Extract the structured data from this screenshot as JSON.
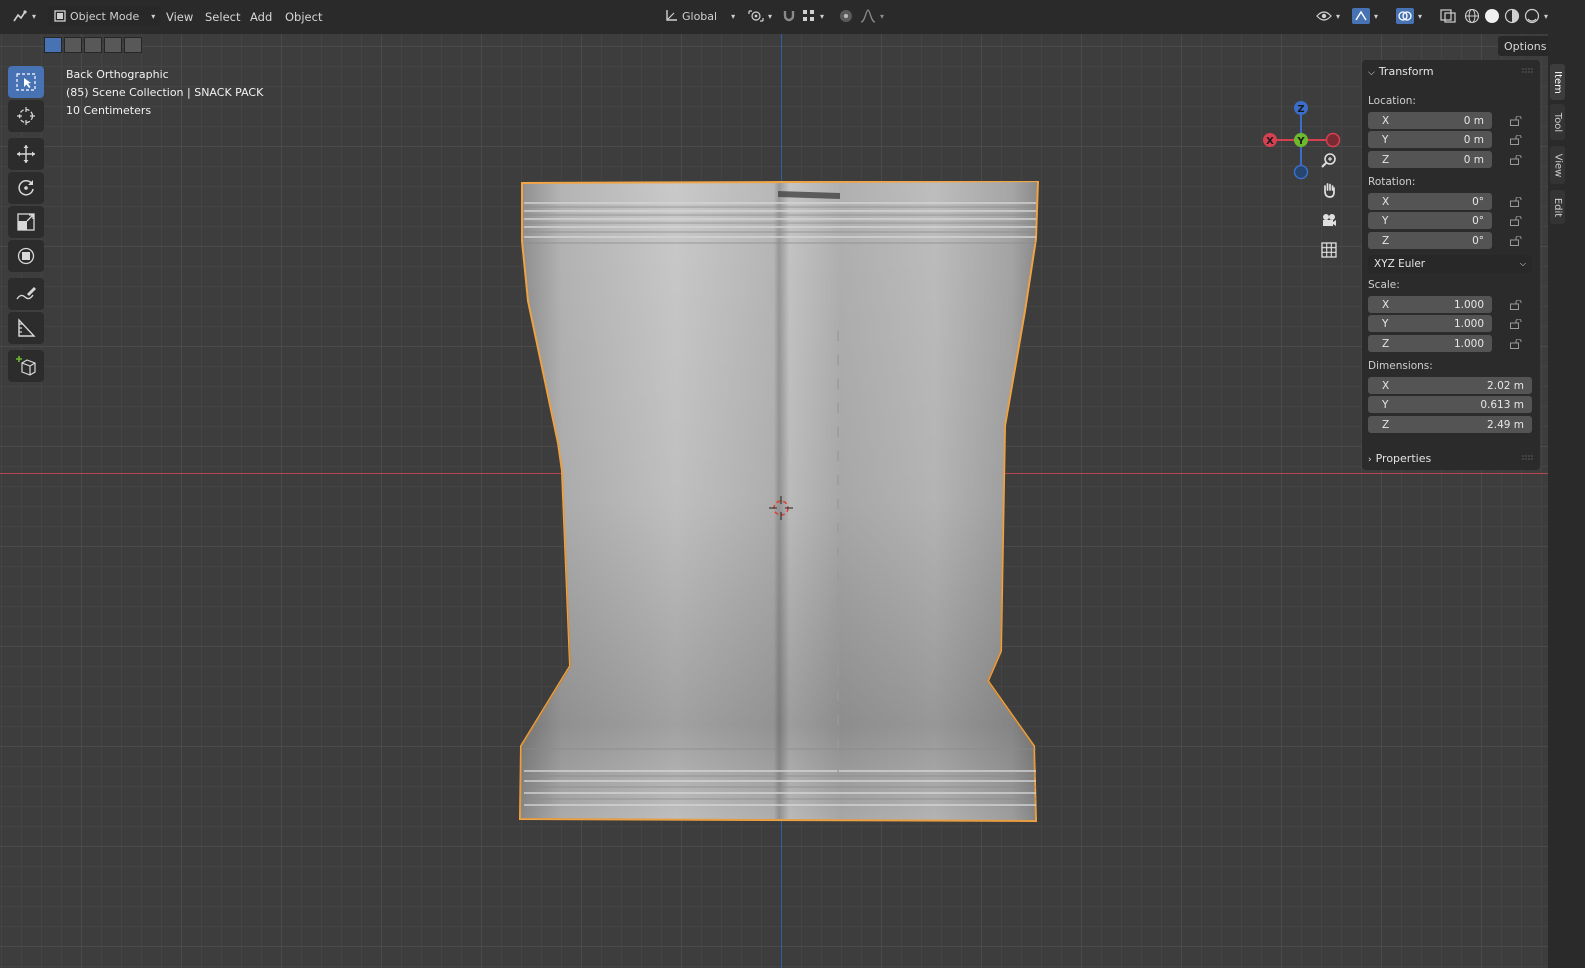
{
  "header": {
    "mode": "Object Mode",
    "menus": [
      "View",
      "Select",
      "Add",
      "Object"
    ],
    "transform_orientation": "Global",
    "options_label": "Options"
  },
  "viewport": {
    "view_name": "Back Orthographic",
    "collection_line": "(85) Scene Collection | SNACK PACK",
    "scale_line": "10 Centimeters",
    "gizmo": {
      "x": "X",
      "y": "Y",
      "z": "Z"
    }
  },
  "tools": [
    "select-box-icon",
    "cursor-icon",
    "move-icon",
    "rotate-icon",
    "scale-icon",
    "transform-icon",
    "annotate-icon",
    "measure-icon",
    "add-cube-icon"
  ],
  "nav_icons": [
    "zoom-icon",
    "pan-hand-icon",
    "camera-icon",
    "grid-view-icon"
  ],
  "sidebar": {
    "transform_title": "Transform",
    "location_label": "Location:",
    "location": [
      {
        "axis": "X",
        "value": "0 m"
      },
      {
        "axis": "Y",
        "value": "0 m"
      },
      {
        "axis": "Z",
        "value": "0 m"
      }
    ],
    "rotation_label": "Rotation:",
    "rotation": [
      {
        "axis": "X",
        "value": "0°"
      },
      {
        "axis": "Y",
        "value": "0°"
      },
      {
        "axis": "Z",
        "value": "0°"
      }
    ],
    "rotation_mode": "XYZ Euler",
    "scale_label": "Scale:",
    "scale": [
      {
        "axis": "X",
        "value": "1.000"
      },
      {
        "axis": "Y",
        "value": "1.000"
      },
      {
        "axis": "Z",
        "value": "1.000"
      }
    ],
    "dimensions_label": "Dimensions:",
    "dimensions": [
      {
        "axis": "X",
        "value": "2.02 m"
      },
      {
        "axis": "Y",
        "value": "0.613 m"
      },
      {
        "axis": "Z",
        "value": "2.49 m"
      }
    ],
    "properties_title": "Properties"
  },
  "side_tabs": [
    "Item",
    "Tool",
    "View",
    "Edit"
  ],
  "colors": {
    "accent": "#4772b3",
    "selection_outline": "#f0a445",
    "axis_x": "#b5454f",
    "axis_z": "#2f5ea8"
  }
}
